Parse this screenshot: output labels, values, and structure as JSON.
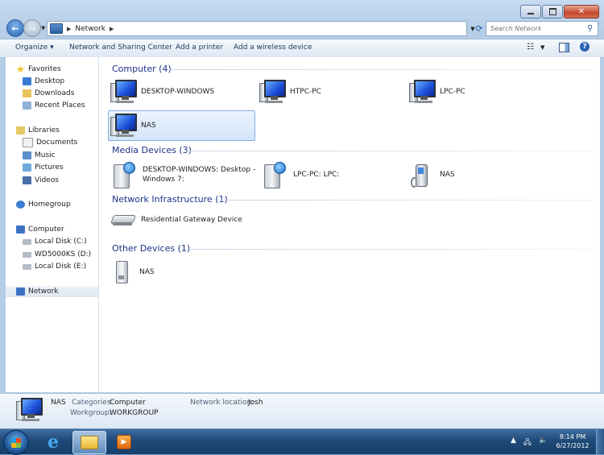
{
  "window": {
    "address": {
      "root": "Network"
    },
    "search_placeholder": "Search Network"
  },
  "toolbar": {
    "organize": "Organize ▾",
    "network_sharing": "Network and Sharing Center",
    "add_printer": "Add a printer",
    "add_wireless": "Add a wireless device"
  },
  "nav": {
    "favorites": "Favorites",
    "desktop": "Desktop",
    "downloads": "Downloads",
    "recent": "Recent Places",
    "libraries": "Libraries",
    "documents": "Documents",
    "music": "Music",
    "pictures": "Pictures",
    "videos": "Videos",
    "homegroup": "Homegroup",
    "computer": "Computer",
    "disk_c": "Local Disk (C:)",
    "disk_d": "WD5000KS (D:)",
    "disk_e": "Local Disk (E:)",
    "network": "Network"
  },
  "groups": {
    "computer": {
      "header": "Computer (4)",
      "items": [
        "DESKTOP-WINDOWS",
        "HTPC-PC",
        "LPC-PC",
        "NAS"
      ]
    },
    "media": {
      "header": "Media Devices (3)",
      "item1_line1": "DESKTOP-WINDOWS: Desktop -",
      "item1_line2": "Windows 7:",
      "item2": "LPC-PC: LPC:",
      "item3": "NAS"
    },
    "infra": {
      "header": "Network Infrastructure (1)",
      "item1": "Residential Gateway Device"
    },
    "other": {
      "header": "Other Devices (1)",
      "item1": "NAS"
    }
  },
  "details": {
    "name": "NAS",
    "categories_label": "Categories:",
    "categories_value": "Computer",
    "workgroup_label": "Workgroup:",
    "workgroup_value": "WORKGROUP",
    "location_label": "Network location:",
    "location_value": "Josh"
  },
  "taskbar": {
    "time": "8:14 PM",
    "date": "6/27/2012"
  },
  "colors": {
    "group_header": "#1e3287",
    "selection": "#d4e5f9",
    "taskbar": "#1f4a79"
  }
}
